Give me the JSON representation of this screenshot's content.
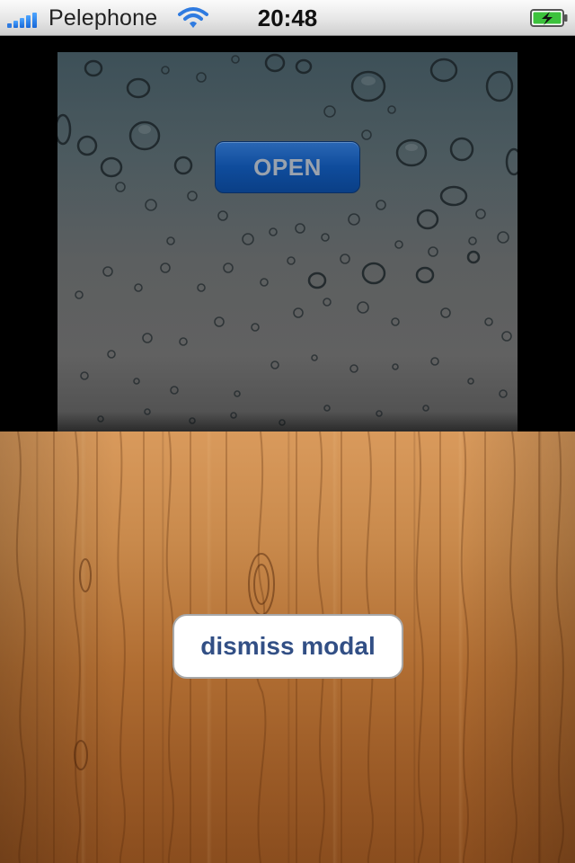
{
  "status_bar": {
    "carrier": "Pelephone",
    "time": "20:48",
    "signal_bars": 5,
    "wifi_icon": "wifi-icon",
    "battery_icon": "battery-charging-icon",
    "battery_color": "#3cc23c"
  },
  "top_panel": {
    "open_button_label": "OPEN",
    "open_button_color": "#0f4c9c",
    "background": "rain-drops-wallpaper"
  },
  "modal": {
    "dismiss_button_label": "dismiss modal",
    "dismiss_text_color": "#324f85",
    "background": "wood-texture"
  }
}
